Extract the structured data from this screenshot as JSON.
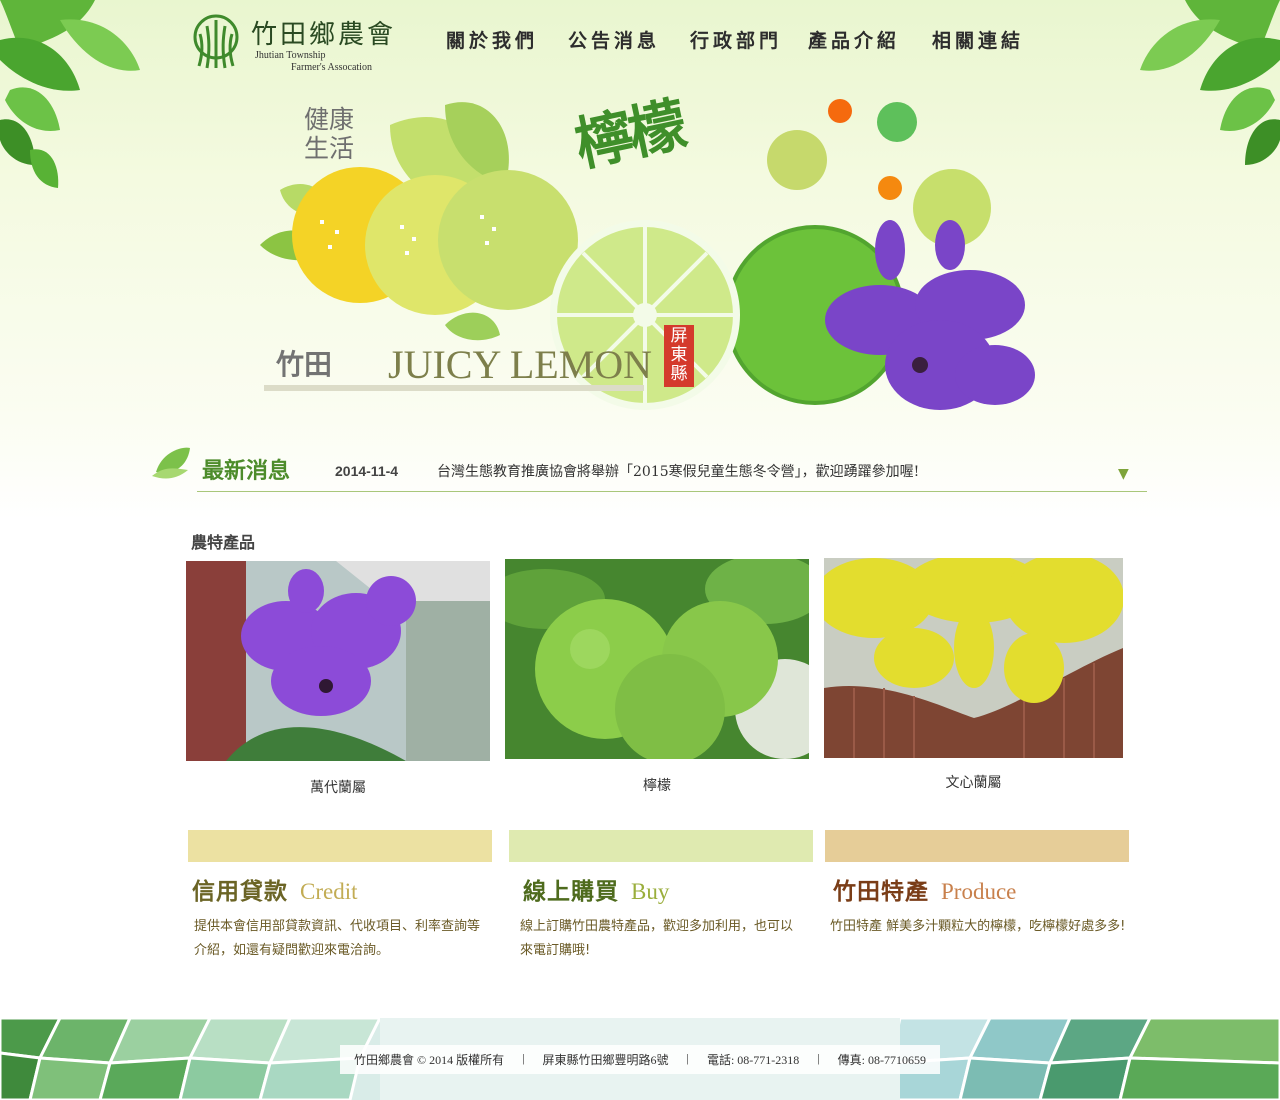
{
  "header": {
    "logo_cn": "竹田鄉農會",
    "logo_en_line1": "Jhutian Township",
    "logo_en_line2": "Farmer's Assocation",
    "nav": [
      "關於我們",
      "公告消息",
      "行政部門",
      "產品介紹",
      "相關連結"
    ]
  },
  "hero": {
    "health_line1": "健康",
    "health_line2": "生活",
    "lemon_title": "檸檬",
    "brand_cn": "竹田",
    "brand_en": "JUICY LEMON",
    "stamp": "屏東縣"
  },
  "news": {
    "heading": "最新消息",
    "date": "2014-11-4",
    "text": "台灣生態教育推廣協會將舉辦「2015寒假兒童生態冬令營」，歡迎踴躍參加喔!",
    "arrow": "▼"
  },
  "products": {
    "title": "農特產品",
    "items": [
      "萬代蘭屬",
      "檸檬",
      "文心蘭屬"
    ]
  },
  "features": [
    {
      "cn": "信用貸款",
      "en": "Credit",
      "desc": "提供本會信用部貸款資訊、代收項目、利率查詢等介紹，如還有疑問歡迎來電洽詢。",
      "bar_color": "#ece1a2",
      "cn_color": "#6b6425",
      "en_color": "#c2ac54"
    },
    {
      "cn": "線上購買",
      "en": "Buy",
      "desc": "線上訂購竹田農特產品，歡迎多加利用，也可以來電訂購哦!",
      "bar_color": "#dfeab0",
      "cn_color": "#4e6b1d",
      "en_color": "#9aae3c"
    },
    {
      "cn": "竹田特產",
      "en": "Produce",
      "desc": "竹田特產 鮮美多汁顆粒大的檸檬，吃檸檬好處多多!",
      "bar_color": "#e6cd98",
      "cn_color": "#7a3d17",
      "en_color": "#c8804c"
    }
  ],
  "footer": {
    "copyright": "竹田鄉農會 © 2014 版權所有",
    "address": "屏東縣竹田鄉豐明路6號",
    "phone": "電話: 08-771-2318",
    "fax": "傳真: 08-7710659",
    "sep": "|"
  },
  "colors": {
    "accent_green": "#4d8c2b",
    "news_line": "#a9c77a"
  }
}
